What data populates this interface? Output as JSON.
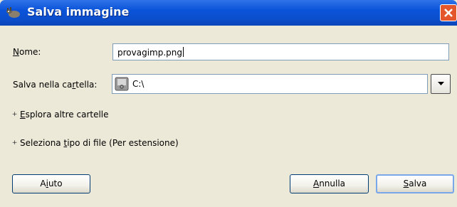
{
  "window": {
    "title": "Salva immagine",
    "icon": "gimp-wilber-icon",
    "close_icon": "close-icon"
  },
  "form": {
    "name_label_prefix": "",
    "name_label_accel": "N",
    "name_label_rest": "ome:",
    "name_value": "provagimp.png",
    "folder_label_prefix": "Salva nella ca",
    "folder_label_accel": "r",
    "folder_label_rest": "tella:",
    "folder_value": "C:\\",
    "folder_icon": "drive-icon"
  },
  "expanders": {
    "browse_accel": "E",
    "browse_rest": "splora altre cartelle",
    "filetype_prefix": "Seleziona ",
    "filetype_accel": "t",
    "filetype_rest": "ipo di file (Per estensione)",
    "expand_glyph": "+"
  },
  "buttons": {
    "help_prefix": "A",
    "help_accel": "i",
    "help_rest": "uto",
    "cancel_accel": "A",
    "cancel_rest": "nnulla",
    "save_accel": "S",
    "save_rest": "alva"
  },
  "colors": {
    "titlebar": "#0b4ecc",
    "close": "#e4572c",
    "dialog_bg": "#ece9d8"
  }
}
